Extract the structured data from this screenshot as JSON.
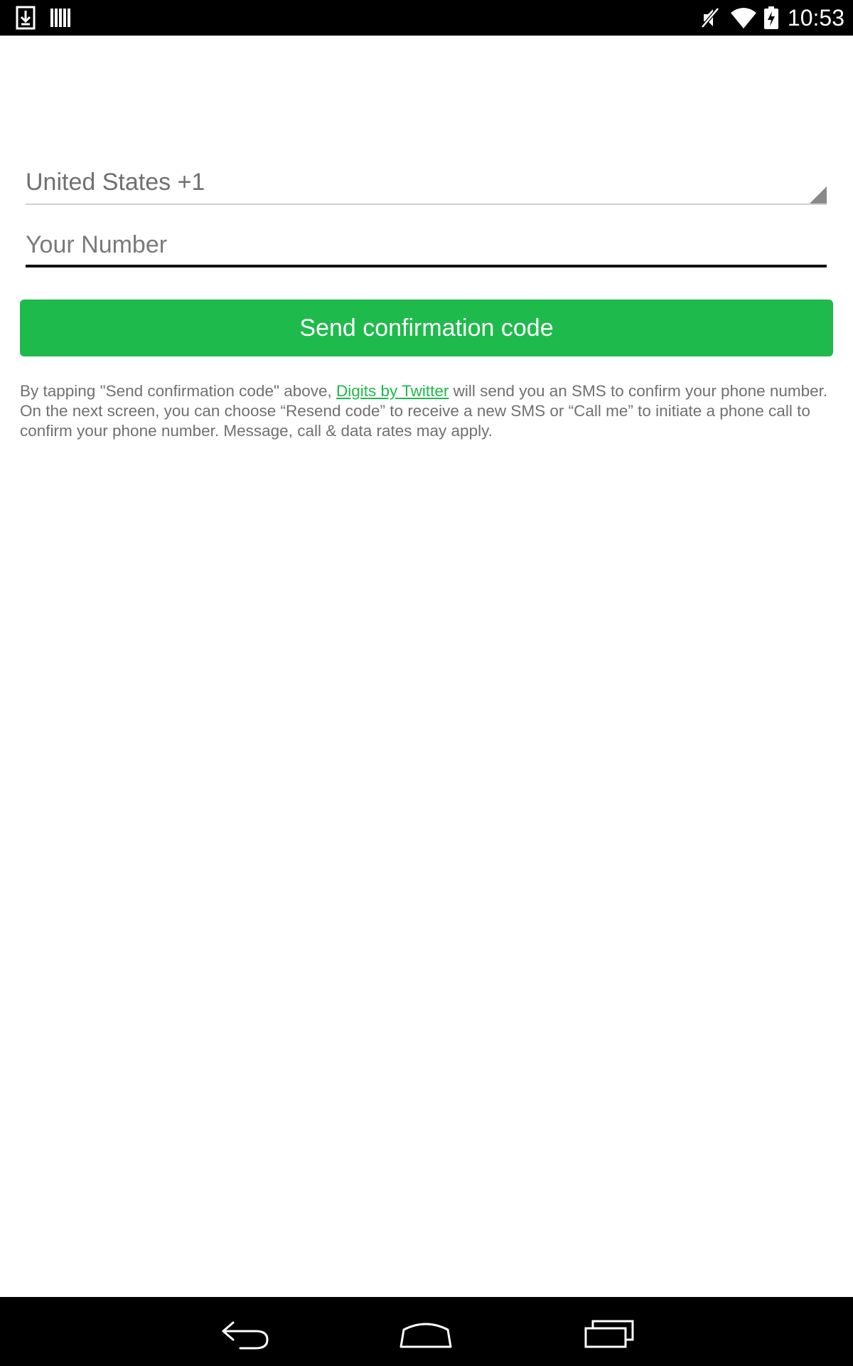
{
  "status_bar": {
    "time": "10:53",
    "left_icons": [
      "download-icon",
      "barcode-icon"
    ],
    "right_icons": [
      "muted-icon",
      "wifi-icon",
      "battery-charging-icon"
    ]
  },
  "form": {
    "country": "United States +1",
    "number_placeholder": "Your Number",
    "number_value": ""
  },
  "send_button": {
    "label": "Send confirmation code",
    "color": "#1fba4c"
  },
  "disclaimer": {
    "before_link": "By tapping \"Send confirmation code\" above, ",
    "link_text": "Digits by Twitter",
    "after_link": " will send you an SMS to confirm your phone number. On the next screen, you can choose “Resend code” to receive a new SMS or “Call me” to initiate a phone call to confirm your phone number. Message, call & data rates may apply."
  },
  "nav_bar": {
    "buttons": [
      "back-icon",
      "home-icon",
      "recent-apps-icon"
    ]
  }
}
